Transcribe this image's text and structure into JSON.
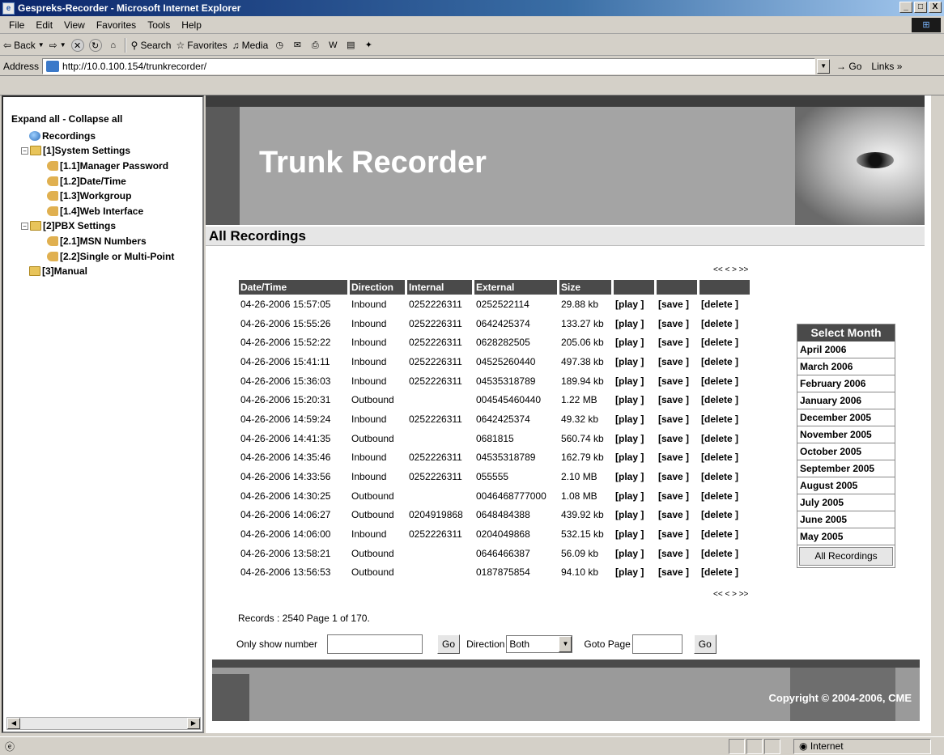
{
  "window": {
    "title": "Gespreks-Recorder - Microsoft Internet Explorer",
    "minimize": "_",
    "maximize": "□",
    "close": "X"
  },
  "menu": [
    "File",
    "Edit",
    "View",
    "Favorites",
    "Tools",
    "Help"
  ],
  "toolbar": {
    "back": "Back",
    "search": "Search",
    "favorites": "Favorites",
    "media": "Media"
  },
  "address": {
    "label": "Address",
    "url": "http://10.0.100.154/trunkrecorder/",
    "go": "Go",
    "links": "Links"
  },
  "tree": {
    "expand": "Expand all - Collapse all",
    "recordings": "Recordings",
    "system": "[1]System Settings",
    "system_items": [
      "[1.1]Manager Password",
      "[1.2]Date/Time",
      "[1.3]Workgroup",
      "[1.4]Web Interface"
    ],
    "pbx": "[2]PBX Settings",
    "pbx_items": [
      "[2.1]MSN Numbers",
      "[2.2]Single or Multi-Point"
    ],
    "manual": "[3]Manual"
  },
  "banner": {
    "title": "Trunk Recorder"
  },
  "page": {
    "heading": "All Recordings",
    "pager": "<< < > >>"
  },
  "table": {
    "headers": [
      "Date/Time",
      "Direction",
      "Internal",
      "External",
      "Size",
      "",
      "",
      ""
    ],
    "rows": [
      [
        "04-26-2006 15:57:05",
        "Inbound",
        "0252226311",
        "0252522114",
        "29.88 kb"
      ],
      [
        "04-26-2006 15:55:26",
        "Inbound",
        "0252226311",
        "0642425374",
        "133.27 kb"
      ],
      [
        "04-26-2006 15:52:22",
        "Inbound",
        "0252226311",
        "0628282505",
        "205.06 kb"
      ],
      [
        "04-26-2006 15:41:11",
        "Inbound",
        "0252226311",
        "04525260440",
        "497.38 kb"
      ],
      [
        "04-26-2006 15:36:03",
        "Inbound",
        "0252226311",
        "04535318789",
        "189.94 kb"
      ],
      [
        "04-26-2006 15:20:31",
        "Outbound",
        "",
        "004545460440",
        "1.22 MB"
      ],
      [
        "04-26-2006 14:59:24",
        "Inbound",
        "0252226311",
        "0642425374",
        "49.32 kb"
      ],
      [
        "04-26-2006 14:41:35",
        "Outbound",
        "",
        "0681815",
        "560.74 kb"
      ],
      [
        "04-26-2006 14:35:46",
        "Inbound",
        "0252226311",
        "04535318789",
        "162.79 kb"
      ],
      [
        "04-26-2006 14:33:56",
        "Inbound",
        "0252226311",
        "055555",
        "2.10 MB"
      ],
      [
        "04-26-2006 14:30:25",
        "Outbound",
        "",
        "0046468777000",
        "1.08 MB"
      ],
      [
        "04-26-2006 14:06:27",
        "Outbound",
        "0204919868",
        "0648484388",
        "439.92 kb"
      ],
      [
        "04-26-2006 14:06:00",
        "Inbound",
        "0252226311",
        "0204049868",
        "532.15 kb"
      ],
      [
        "04-26-2006 13:58:21",
        "Outbound",
        "",
        "0646466387",
        "56.09 kb"
      ],
      [
        "04-26-2006 13:56:53",
        "Outbound",
        "",
        "0187875854",
        "94.10 kb"
      ]
    ],
    "actions": [
      "[play ]",
      "[save ]",
      "[delete ]"
    ]
  },
  "months": {
    "header": "Select Month",
    "items": [
      "April 2006",
      "March 2006",
      "February 2006",
      "January 2006",
      "December 2005",
      "November 2005",
      "October 2005",
      "September 2005",
      "August 2005",
      "July 2005",
      "June 2005",
      "May 2005"
    ],
    "all": "All Recordings"
  },
  "records": "Records : 2540 Page 1 of 170.",
  "filter": {
    "only_label": "Only show number",
    "go": "Go",
    "direction_label": "Direction",
    "direction_value": "Both",
    "goto_label": "Goto Page"
  },
  "footer": {
    "copyright": "Copyright © 2004-2006, CME"
  },
  "status": {
    "zone": "Internet"
  }
}
